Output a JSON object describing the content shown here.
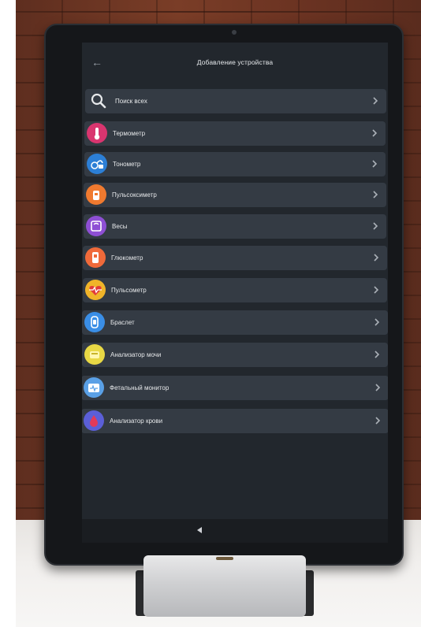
{
  "header": {
    "title": "Добавление устройства"
  },
  "search": {
    "label": "Поиск всех"
  },
  "items": [
    {
      "label": "Термометр",
      "color": "#d9356f",
      "icon": "thermometer-icon"
    },
    {
      "label": "Тонометр",
      "color": "#2c7fd6",
      "icon": "blood-pressure-icon"
    },
    {
      "label": "Пульсоксиметр",
      "color": "#f07a2f",
      "icon": "pulse-oximeter-icon"
    },
    {
      "label": "Весы",
      "color": "#8e4fd4",
      "icon": "scale-icon"
    },
    {
      "label": "Глюкометр",
      "color": "#f06a3a",
      "icon": "glucometer-icon"
    },
    {
      "label": "Пульсометр",
      "color": "#f0b429",
      "icon": "heart-rate-icon"
    },
    {
      "label": "Браслет",
      "color": "#3a8ee6",
      "icon": "bracelet-icon"
    },
    {
      "label": "Анализатор мочи",
      "color": "#e8d845",
      "icon": "urine-analyzer-icon"
    },
    {
      "label": "Фетальный монитор",
      "color": "#5aa0e6",
      "icon": "fetal-monitor-icon"
    },
    {
      "label": "Анализатор крови",
      "color": "#5b5fd8",
      "icon": "blood-analyzer-icon"
    }
  ]
}
